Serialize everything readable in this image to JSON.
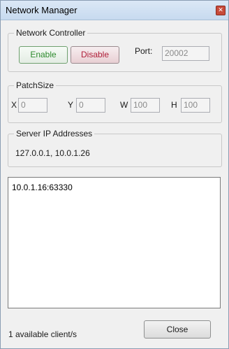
{
  "window": {
    "title": "Network Manager"
  },
  "network_controller": {
    "label": "Network Controller",
    "enable_label": "Enable",
    "disable_label": "Disable",
    "port_label": "Port:",
    "port_value": "20002"
  },
  "patch_size": {
    "label": "PatchSize",
    "x_label": "X",
    "x_value": "0",
    "y_label": "Y",
    "y_value": "0",
    "w_label": "W",
    "w_value": "100",
    "h_label": "H",
    "h_value": "100"
  },
  "server_ip": {
    "label": "Server IP Addresses",
    "addresses": "127.0.0.1, 10.0.1.26"
  },
  "clients": {
    "items": [
      "10.0.1.16:63330"
    ]
  },
  "footer": {
    "status": "1 available client/s",
    "close_label": "Close"
  },
  "colors": {
    "enable_text": "#2e8b2e",
    "disable_text": "#b0203a",
    "titlebar": "#c7daef"
  }
}
